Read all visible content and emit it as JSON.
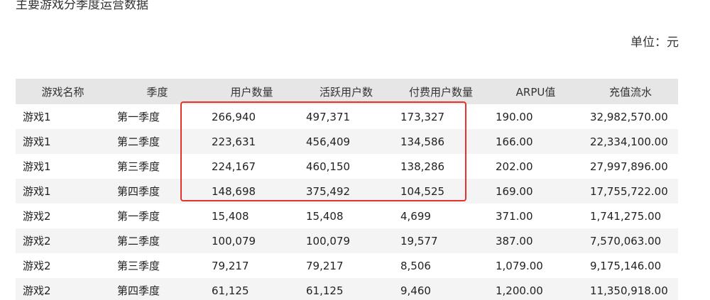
{
  "title": "主要游戏分季度运营数据",
  "unit_label": "单位：元",
  "table": {
    "headers": [
      "游戏名称",
      "季度",
      "用户数量",
      "活跃用户数",
      "付费用户数量",
      "ARPU值",
      "充值流水"
    ],
    "rows": [
      [
        "游戏1",
        "第一季度",
        "266,940",
        "497,371",
        "173,327",
        "190.00",
        "32,982,570.00"
      ],
      [
        "游戏1",
        "第二季度",
        "223,631",
        "456,409",
        "134,586",
        "166.00",
        "22,334,100.00"
      ],
      [
        "游戏1",
        "第三季度",
        "224,167",
        "460,150",
        "138,286",
        "202.00",
        "27,997,896.00"
      ],
      [
        "游戏1",
        "第四季度",
        "148,698",
        "375,492",
        "104,525",
        "169.00",
        "17,755,722.00"
      ],
      [
        "游戏2",
        "第一季度",
        "15,408",
        "15,408",
        "4,699",
        "371.00",
        "1,741,275.00"
      ],
      [
        "游戏2",
        "第二季度",
        "100,079",
        "100,079",
        "19,577",
        "387.00",
        "7,570,063.00"
      ],
      [
        "游戏2",
        "第三季度",
        "79,217",
        "79,217",
        "8,506",
        "1,079.00",
        "9,175,146.00"
      ],
      [
        "游戏2",
        "第四季度",
        "61,125",
        "61,125",
        "9,460",
        "1,200.00",
        "11,350,918.00"
      ]
    ]
  },
  "colors": {
    "header_bg": "#e6e6e6",
    "stripe_bg": "#f4f4f4",
    "highlight_border": "#e5322d"
  }
}
